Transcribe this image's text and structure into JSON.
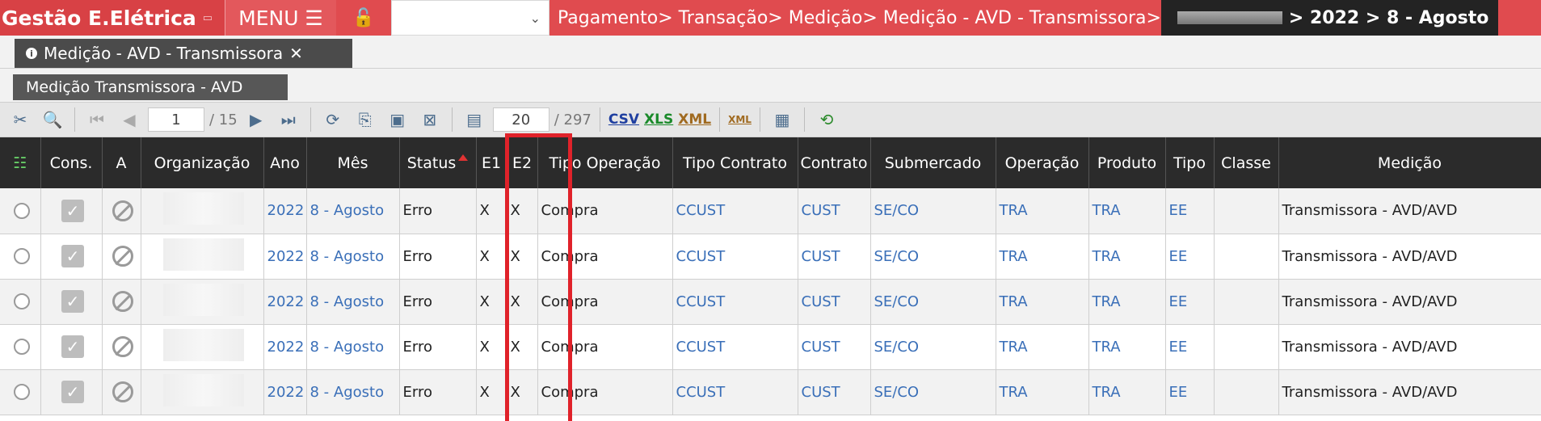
{
  "topbar": {
    "app_title": "Gestão E.Elétrica",
    "menu_label": "MENU ☰",
    "breadcrumb": "Pagamento> Transação> Medição> Medição - AVD - Transmissora>",
    "breadcrumb_tail": "> 2022 > 8 - Agosto"
  },
  "tab": {
    "label": "Medição - AVD - Transmissora"
  },
  "subtitle": "Medição Transmissora - AVD",
  "toolbar": {
    "page": "1",
    "pages_total": "/ 15",
    "rows": "20",
    "rows_total": "/ 297",
    "csv": "CSV",
    "xls": "XLS",
    "xml": "XML",
    "xml2": "XML"
  },
  "columns": [
    "",
    "Cons.",
    "A",
    "Organização",
    "Ano",
    "Mês",
    "Status",
    "E1",
    "E2",
    "Tipo Operação",
    "Tipo Contrato",
    "Contrato",
    "Submercado",
    "Operação",
    "Produto",
    "Tipo",
    "Classe",
    "Medição"
  ],
  "rows": [
    {
      "ano": "2022",
      "mes": "8 - Agosto",
      "status": "Erro",
      "e1": "X",
      "e2": "X",
      "tipo_operacao": "Compra",
      "tipo_contrato": "CCUST",
      "contrato": "CUST",
      "submercado": "SE/CO",
      "operacao": "TRA",
      "produto": "TRA",
      "tipo": "EE",
      "classe": "",
      "medicao": "Transmissora - AVD/AVD"
    },
    {
      "ano": "2022",
      "mes": "8 - Agosto",
      "status": "Erro",
      "e1": "X",
      "e2": "X",
      "tipo_operacao": "Compra",
      "tipo_contrato": "CCUST",
      "contrato": "CUST",
      "submercado": "SE/CO",
      "operacao": "TRA",
      "produto": "TRA",
      "tipo": "EE",
      "classe": "",
      "medicao": "Transmissora - AVD/AVD"
    },
    {
      "ano": "2022",
      "mes": "8 - Agosto",
      "status": "Erro",
      "e1": "X",
      "e2": "X",
      "tipo_operacao": "Compra",
      "tipo_contrato": "CCUST",
      "contrato": "CUST",
      "submercado": "SE/CO",
      "operacao": "TRA",
      "produto": "TRA",
      "tipo": "EE",
      "classe": "",
      "medicao": "Transmissora - AVD/AVD"
    },
    {
      "ano": "2022",
      "mes": "8 - Agosto",
      "status": "Erro",
      "e1": "X",
      "e2": "X",
      "tipo_operacao": "Compra",
      "tipo_contrato": "CCUST",
      "contrato": "CUST",
      "submercado": "SE/CO",
      "operacao": "TRA",
      "produto": "TRA",
      "tipo": "EE",
      "classe": "",
      "medicao": "Transmissora - AVD/AVD"
    },
    {
      "ano": "2022",
      "mes": "8 - Agosto",
      "status": "Erro",
      "e1": "X",
      "e2": "X",
      "tipo_operacao": "Compra",
      "tipo_contrato": "CCUST",
      "contrato": "CUST",
      "submercado": "SE/CO",
      "operacao": "TRA",
      "produto": "TRA",
      "tipo": "EE",
      "classe": "",
      "medicao": "Transmissora - AVD/AVD"
    }
  ],
  "colors": {
    "topbar": "#e04b4f",
    "header_bg": "#2b2b2b",
    "link": "#3a6fb8",
    "highlight_box": "#e0222a"
  }
}
